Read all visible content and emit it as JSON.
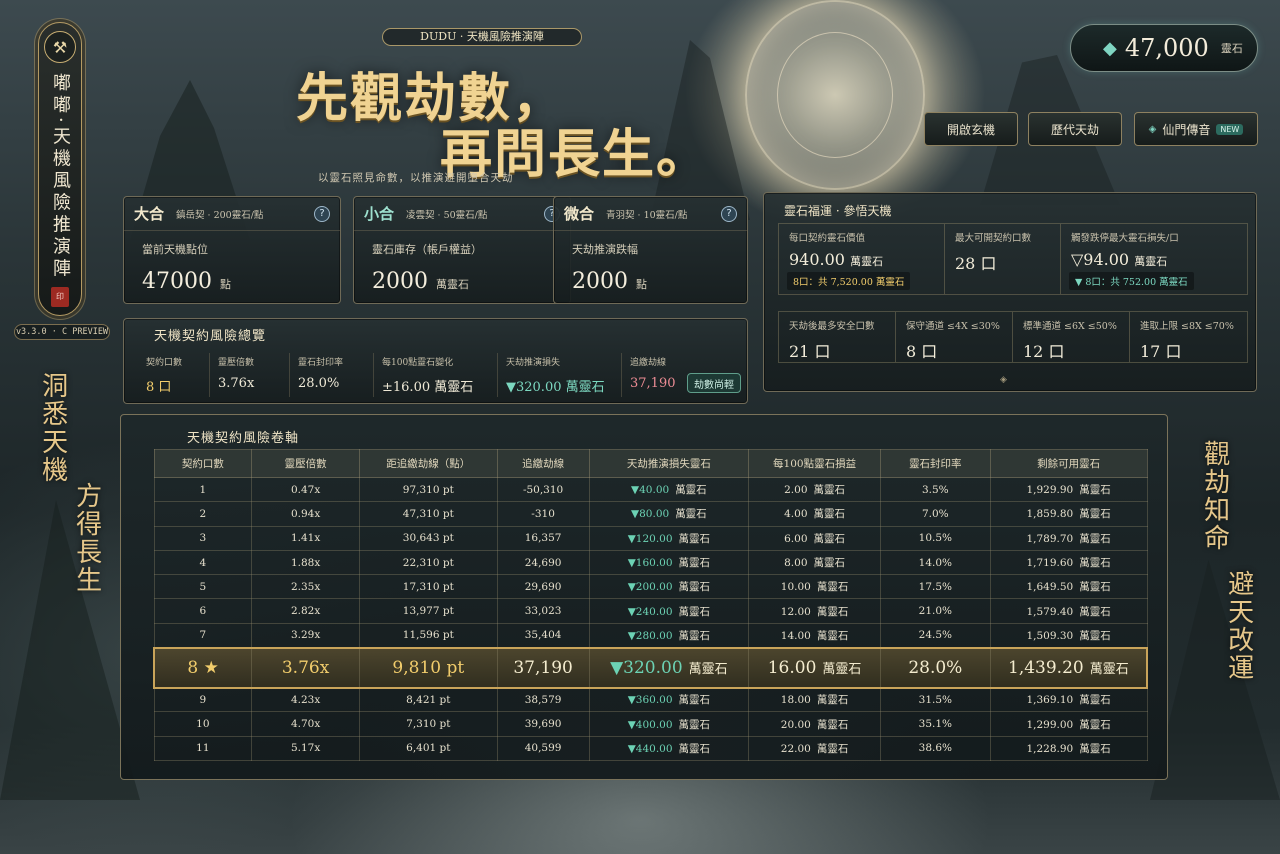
{
  "side": {
    "banner_text": "嘟嘟·天機風險推演陣",
    "version": "v3.3.0 · C PREVIEW"
  },
  "poems": {
    "left_1": "洞悉天機",
    "left_2": "方得長生",
    "right_1": "觀劫知命",
    "right_2": "避天改運"
  },
  "header": {
    "tag": "DUDU · 天機風險推演陣",
    "hero_line1": "先觀劫數，",
    "hero_line2": "再問長生。",
    "subtitle": "以靈石照見命數，以推演避開墮合天劫"
  },
  "wallet": {
    "amount": "47,000",
    "unit": "靈石"
  },
  "nav": {
    "btn1": "開啟玄機",
    "btn2": "歷代天劫",
    "btn3": "仙門傳音",
    "badge": "NEW"
  },
  "cards": [
    {
      "title": "大合",
      "sub": "鎮岳契 · 200靈石/點",
      "label": "當前天機點位",
      "value": "47000",
      "unit": "點"
    },
    {
      "title": "小合",
      "sub": "凌雲契 · 50靈石/點",
      "label": "靈石庫存（帳戶權益）",
      "value": "2000",
      "unit": "萬靈石"
    },
    {
      "title": "微合",
      "sub": "青羽契 · 10靈石/點",
      "label": "天劫推演跌幅",
      "value": "2000",
      "unit": "點"
    }
  ],
  "overview": {
    "title": "天機契約風險總覽",
    "items": [
      {
        "k": "契約口數",
        "v": "8 口"
      },
      {
        "k": "靈壓倍數",
        "v": "3.76x"
      },
      {
        "k": "靈石封印率",
        "v": "28.0%"
      },
      {
        "k": "每100點靈石變化",
        "v": "±16.00 萬靈石"
      },
      {
        "k": "天劫推演損失",
        "v": "▼320.00 萬靈石"
      },
      {
        "k": "追繳劫線",
        "v": "37,190"
      }
    ],
    "button": "劫數尚輕"
  },
  "fortune": {
    "title": "靈石福運 · 參悟天機",
    "row1": [
      {
        "k": "每口契約靈石價值",
        "v": "940.00",
        "u": "萬靈石",
        "note": "8口：共 7,520.00 萬靈石"
      },
      {
        "k": "最大可開契約口數",
        "v": "28 口"
      },
      {
        "k": "觸發跌停最大靈石損失/口",
        "v": "▽94.00",
        "u": "萬靈石",
        "note": "▼ 8口：共 752.00 萬靈石"
      }
    ],
    "row2": [
      {
        "k": "天劫後最多安全口數",
        "v": "21 口"
      },
      {
        "k": "保守通道 ≤4X ≤30%",
        "v": "8 口"
      },
      {
        "k": "標準通道 ≤6X ≤50%",
        "v": "12 口"
      },
      {
        "k": "進取上限 ≤8X ≤70%",
        "v": "17 口"
      }
    ]
  },
  "table": {
    "title": "天機契約風險卷軸",
    "headers": [
      "契約口數",
      "靈壓倍數",
      "距追繳劫線（點）",
      "追繳劫線",
      "天劫推演損失靈石",
      "每100點靈石損益",
      "靈石封印率",
      "剩餘可用靈石"
    ],
    "unit": "萬靈石",
    "rows": [
      [
        "1",
        "0.47x",
        "97,310 pt",
        "-50,310",
        "▼40.00",
        "2.00",
        "3.5%",
        "1,929.90"
      ],
      [
        "2",
        "0.94x",
        "47,310 pt",
        "-310",
        "▼80.00",
        "4.00",
        "7.0%",
        "1,859.80"
      ],
      [
        "3",
        "1.41x",
        "30,643 pt",
        "16,357",
        "▼120.00",
        "6.00",
        "10.5%",
        "1,789.70"
      ],
      [
        "4",
        "1.88x",
        "22,310 pt",
        "24,690",
        "▼160.00",
        "8.00",
        "14.0%",
        "1,719.60"
      ],
      [
        "5",
        "2.35x",
        "17,310 pt",
        "29,690",
        "▼200.00",
        "10.00",
        "17.5%",
        "1,649.50"
      ],
      [
        "6",
        "2.82x",
        "13,977 pt",
        "33,023",
        "▼240.00",
        "12.00",
        "21.0%",
        "1,579.40"
      ],
      [
        "7",
        "3.29x",
        "11,596 pt",
        "35,404",
        "▼280.00",
        "14.00",
        "24.5%",
        "1,509.30"
      ],
      [
        "8 ★",
        "3.76x",
        "9,810 pt",
        "37,190",
        "▼320.00",
        "16.00",
        "28.0%",
        "1,439.20"
      ],
      [
        "9",
        "4.23x",
        "8,421 pt",
        "38,579",
        "▼360.00",
        "18.00",
        "31.5%",
        "1,369.10"
      ],
      [
        "10",
        "4.70x",
        "7,310 pt",
        "39,690",
        "▼400.00",
        "20.00",
        "35.1%",
        "1,299.00"
      ],
      [
        "11",
        "5.17x",
        "6,401 pt",
        "40,599",
        "▼440.00",
        "22.00",
        "38.6%",
        "1,228.90"
      ]
    ],
    "highlight_index": 7
  },
  "colors": {
    "gold": "#f2cd6c",
    "teal": "#7cd8c0",
    "red": "#ec8c94"
  }
}
